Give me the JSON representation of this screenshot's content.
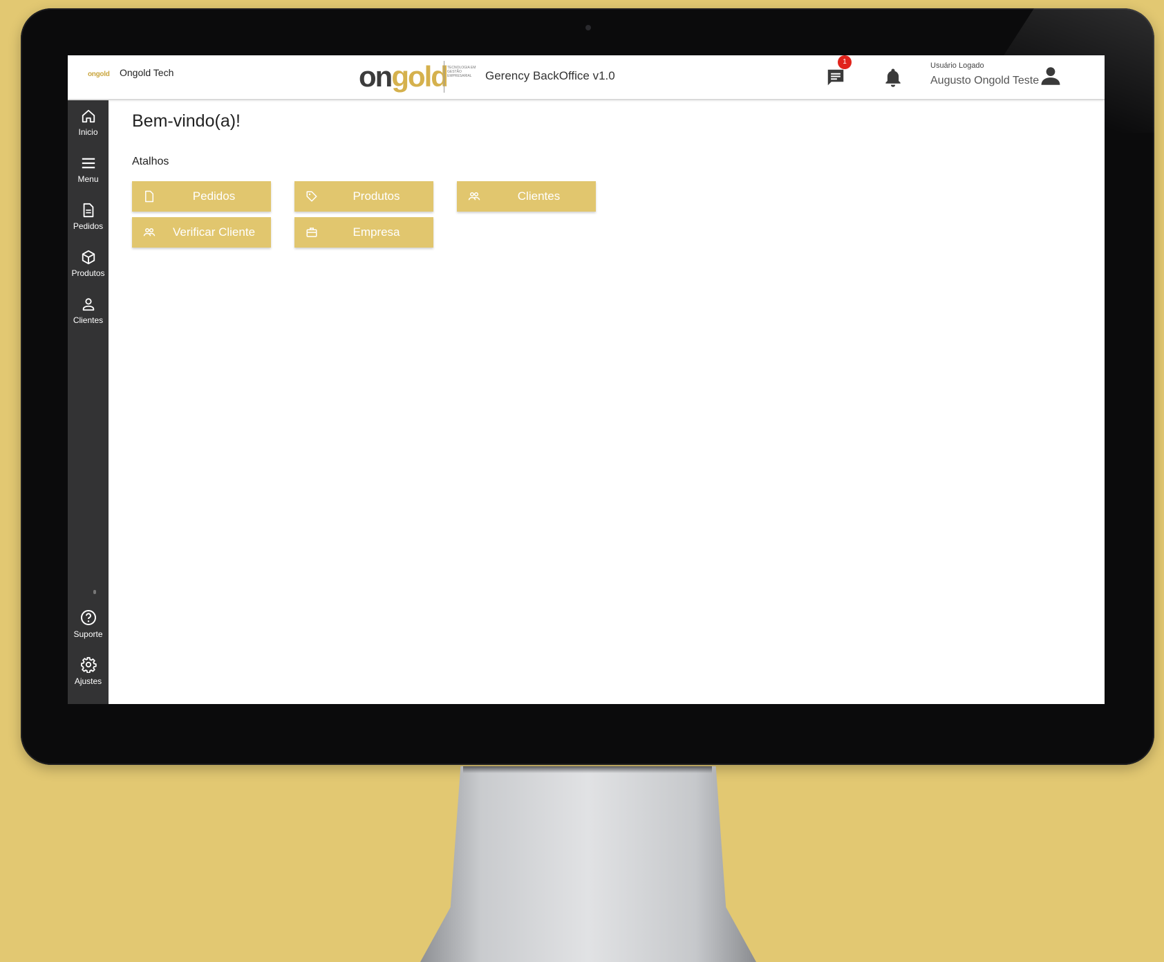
{
  "header": {
    "small_logo": "ongold",
    "company_name": "Ongold Tech",
    "brand_on": "on",
    "brand_gold": "gold",
    "brand_tagline": "Tecnologia em Gestão Empresarial",
    "system_name": "Gerency BackOffice v1.0",
    "chat_badge_count": "1",
    "user_label": "Usuário Logado",
    "user_name": "Augusto Ongold Teste"
  },
  "sidebar": {
    "items": [
      {
        "label": "Inicio",
        "icon": "home-icon"
      },
      {
        "label": "Menu",
        "icon": "menu-icon"
      },
      {
        "label": "Pedidos",
        "icon": "document-icon"
      },
      {
        "label": "Produtos",
        "icon": "box-icon"
      },
      {
        "label": "Clientes",
        "icon": "user-icon"
      }
    ],
    "bottom_items": [
      {
        "label": "Suporte",
        "icon": "help-icon"
      },
      {
        "label": "Ajustes",
        "icon": "gear-icon"
      }
    ]
  },
  "main": {
    "welcome": "Bem-vindo(a)!",
    "shortcuts_title": "Atalhos",
    "shortcuts": [
      {
        "label": "Pedidos",
        "icon": "document-icon"
      },
      {
        "label": "Produtos",
        "icon": "tag-icon"
      },
      {
        "label": "Clientes",
        "icon": "people-icon"
      },
      {
        "label": "Verificar Cliente",
        "icon": "people-icon"
      },
      {
        "label": "Empresa",
        "icon": "briefcase-icon"
      }
    ]
  },
  "colors": {
    "accent": "#e1c66e",
    "sidebar": "#333334",
    "background": "#e2c872",
    "badge": "#e1241c"
  }
}
